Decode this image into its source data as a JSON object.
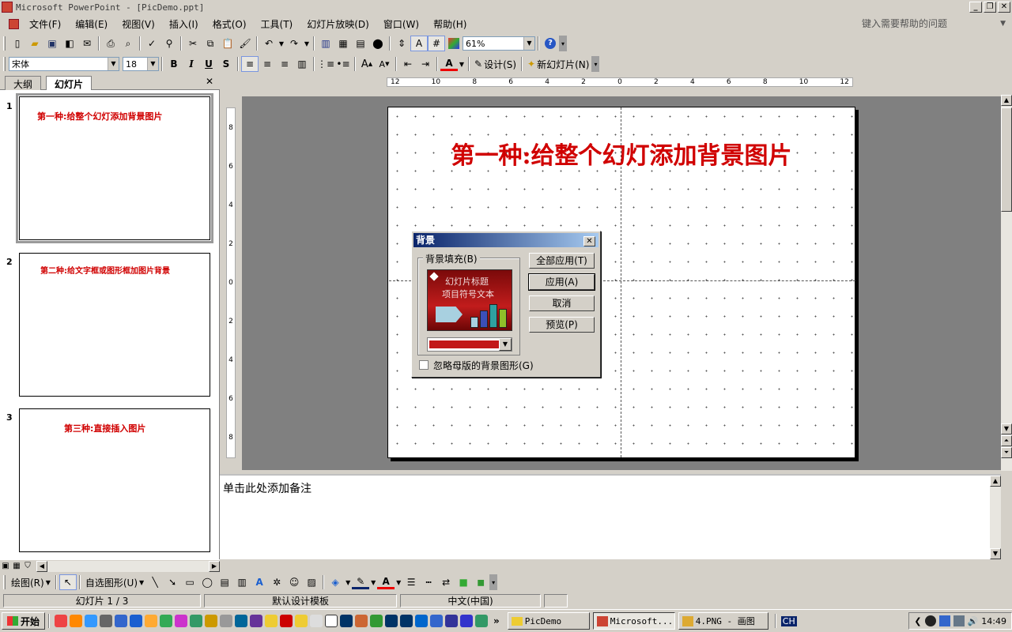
{
  "window": {
    "title": "Microsoft PowerPoint - [PicDemo.ppt]"
  },
  "menu": [
    "文件(F)",
    "编辑(E)",
    "视图(V)",
    "插入(I)",
    "格式(O)",
    "工具(T)",
    "幻灯片放映(D)",
    "窗口(W)",
    "帮助(H)"
  ],
  "help_box": {
    "placeholder": "键入需要帮助的问题"
  },
  "toolbar": {
    "zoom": "61%"
  },
  "format_toolbar": {
    "font": "宋体",
    "size": "18",
    "bold": "B",
    "italic": "I",
    "underline": "U",
    "shadow": "S",
    "design": "设计(S)",
    "new_slide": "新幻灯片(N)"
  },
  "left_panel": {
    "tabs": [
      "大纲",
      "幻灯片"
    ],
    "thumbnails": [
      {
        "num": "1",
        "text": "第一种:给整个幻灯添加背景图片"
      },
      {
        "num": "2",
        "text": "第二种:给文字框或图形框加图片背景"
      },
      {
        "num": "3",
        "text": "第三种:直接插入图片"
      }
    ]
  },
  "ruler": {
    "h": [
      "12",
      "10",
      "8",
      "6",
      "4",
      "2",
      "0",
      "2",
      "4",
      "6",
      "8",
      "10",
      "12"
    ],
    "v": [
      "8",
      "6",
      "4",
      "2",
      "0",
      "2",
      "4",
      "6",
      "8"
    ]
  },
  "slide": {
    "title": "第一种:给整个幻灯添加背景图片"
  },
  "notes": {
    "placeholder": "单击此处添加备注"
  },
  "dialog": {
    "title": "背景",
    "group_label": "背景填充(B)",
    "preview_title": "幻灯片标题",
    "preview_text": "项目符号文本",
    "buttons": [
      "全部应用(T)",
      "应用(A)",
      "取消",
      "预览(P)"
    ],
    "checkbox_label": "忽略母版的背景图形(G)"
  },
  "draw_toolbar": {
    "draw": "绘图(R)",
    "autoshapes": "自选图形(U)"
  },
  "status": {
    "slide": "幻灯片 1 / 3",
    "template": "默认设计模板",
    "language": "中文(中国)"
  },
  "taskbar": {
    "start": "开始",
    "items": [
      "PicDemo",
      "Microsoft...",
      "4.PNG - 画图"
    ],
    "ime": "CH",
    "time": "14:49"
  },
  "colors": {
    "title_red": "#d00000",
    "stage_gray": "#808080",
    "dialog_title": "#0a246a"
  }
}
